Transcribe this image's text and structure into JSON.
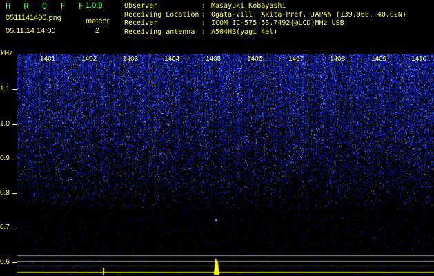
{
  "header": {
    "app_title": "H R O F F T",
    "app_version": "1.0.0",
    "file_name": "0511141400.png",
    "timestamp": "05.11.14 14:00",
    "meteor_label": "meteor",
    "meteor_count": "2"
  },
  "info": [
    {
      "key": "Observer",
      "sep": ":",
      "value": "Masayuki Kobayashi"
    },
    {
      "key": "Receiving Location",
      "sep": ":",
      "value": "Ogata-vill. Akita-Pref. JAPAN (139.96E, 40.02N)"
    },
    {
      "key": "Receiver",
      "sep": ":",
      "value": "ICOM IC-575 53.7492(@LCD)MHz USB"
    },
    {
      "key": "Receiving antenna",
      "sep": ":",
      "value": "A504HB(yagi 4el)"
    }
  ],
  "axes": {
    "y_unit": "kHz",
    "y_ticks": [
      "1.1",
      "1.0",
      "0.9",
      "0.8",
      "0.7",
      "0.6"
    ],
    "x_ticks": [
      "1401",
      "1402",
      "1403",
      "1404",
      "1405",
      "1406",
      "1407",
      "1408",
      "1409",
      "1410"
    ]
  },
  "colors": {
    "text": "#ffff4d",
    "title": "#6cff6c",
    "spectrum": "#1a2bd6",
    "meteor": "#ffff00"
  }
}
